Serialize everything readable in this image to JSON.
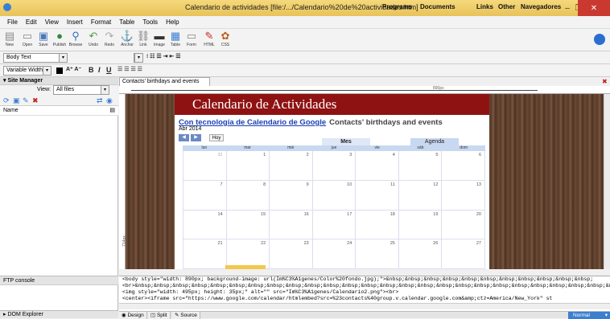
{
  "window": {
    "title": "Calendario de actividades [file:/.../Calendario%20de%20actividades.htm]",
    "bookmarks": [
      "Programs",
      "Documents",
      "Links",
      "Other",
      "Navegadores"
    ]
  },
  "menu": [
    "File",
    "Edit",
    "View",
    "Insert",
    "Format",
    "Table",
    "Tools",
    "Help"
  ],
  "toolbar": [
    {
      "label": "New",
      "icon": "new-document-icon"
    },
    {
      "label": "Open",
      "icon": "open-folder-icon"
    },
    {
      "label": "Save",
      "icon": "save-icon"
    },
    {
      "label": "Publish",
      "icon": "publish-icon"
    },
    {
      "label": "Browse",
      "icon": "browse-icon"
    },
    {
      "label": "Undo",
      "icon": "undo-icon"
    },
    {
      "label": "Redo",
      "icon": "redo-icon"
    },
    {
      "label": "Anchor",
      "icon": "anchor-icon"
    },
    {
      "label": "Link",
      "icon": "link-icon"
    },
    {
      "label": "Image",
      "icon": "image-icon"
    },
    {
      "label": "Table",
      "icon": "table-icon"
    },
    {
      "label": "Form",
      "icon": "form-icon"
    },
    {
      "label": "HTML",
      "icon": "html-icon"
    },
    {
      "label": "CSS",
      "icon": "css-icon"
    }
  ],
  "format": {
    "paragraph": "Body Text",
    "font": "Variable Width",
    "bold": "B",
    "italic": "I",
    "underline": "U"
  },
  "site_manager": {
    "title": "Site Manager",
    "view_label": "View:",
    "view_value": "All files",
    "column": "Name",
    "ftp": "FTP console",
    "dom": "DOM Explorer"
  },
  "document": {
    "tab": "Contacts' birthdays and events",
    "ruler_label": "890px",
    "vruler_label": "714px",
    "banner": "Calendario de Actividades",
    "calendar_link": "Con tecnología de Calendario de Google",
    "calendar_subtitle": "Contacts' birthdays and events",
    "month": "Abr 2014",
    "today_button": "Hoy",
    "views": [
      "Mes",
      "Agenda"
    ],
    "days": [
      "lun",
      "mar",
      "mié",
      "jue",
      "vie",
      "sáb",
      "dom"
    ],
    "weeks": [
      [
        "31",
        "1",
        "2",
        "3",
        "4",
        "5",
        "6"
      ],
      [
        "7",
        "8",
        "9",
        "10",
        "11",
        "12",
        "13"
      ],
      [
        "14",
        "15",
        "16",
        "17",
        "18",
        "19",
        "20"
      ],
      [
        "21",
        "22",
        "23",
        "24",
        "25",
        "26",
        "27"
      ]
    ]
  },
  "code": [
    "<body style=\"width: 890px; background-image: url(Im%C3%A1genes/Color%20fondo.jpg);\">&nbsp;&nbsp;&nbsp;&nbsp;&nbsp;&nbsp;&nbsp;&nbsp;&nbsp;&nbsp;&nbsp;",
    "<br>&nbsp;&nbsp;&nbsp;&nbsp;&nbsp;&nbsp;&nbsp;&nbsp;&nbsp;&nbsp;&nbsp;&nbsp;&nbsp;&nbsp;&nbsp;&nbsp;&nbsp;&nbsp;&nbsp;&nbsp;&nbsp;&nbsp;&nbsp;&nbsp;&nbsp;&nbsp;&nbsp;&nbsp;&nbsp;",
    "<img style=\"width: 495px; height: 35px;\" alt=\"\" src=\"Im%C3%A1genes/Calendario2.png\"><br>",
    "<center><iframe src=\"https://www.google.com/calendar/htmlembed?src=%23contacts%40group.v.calendar.google.com&amp;ctz=America/New_York\" st"
  ],
  "status": {
    "tabs": [
      "Design",
      "Split",
      "Source"
    ],
    "mode": "Normal"
  }
}
